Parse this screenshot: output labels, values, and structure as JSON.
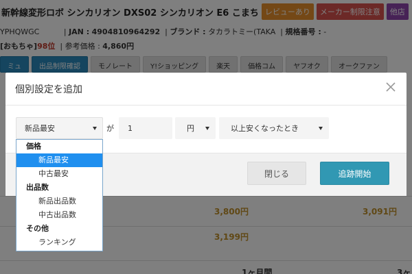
{
  "background": {
    "title": "新幹線変形ロボ シンカリオン DXS02 シンカリオン E6 こまち",
    "badges": [
      {
        "label": "レビューあり",
        "color": "#e8912d"
      },
      {
        "label": "メーカー制限注意",
        "color": "#d9534f"
      },
      {
        "label": "他店",
        "color": "#8e44ad"
      }
    ],
    "info_line1": {
      "asin_tail": "YPHQWGC",
      "jan_label": "JAN :",
      "jan_value": "4904810964292",
      "brand_label": "ブランド :",
      "brand_value": "タカラトミー(TAKA",
      "model_label": "規格番号 :",
      "model_value": "-"
    },
    "info_line2": {
      "category": "[おもちゃ]",
      "rank": "98位",
      "ref_label": "参考価格 :",
      "ref_value": "4,860円"
    },
    "tabs": [
      {
        "label": "ミュ",
        "active": true
      },
      {
        "label": "出品制限確認",
        "active": true
      },
      {
        "label": "モノレート",
        "active": false
      },
      {
        "label": "Y!ショッピング",
        "active": false
      },
      {
        "label": "楽天",
        "active": false
      },
      {
        "label": "価格コム",
        "active": false
      },
      {
        "label": "ヤフオク",
        "active": false
      },
      {
        "label": "オークファン",
        "active": false
      }
    ],
    "table": {
      "price_row1_a": "3,800円",
      "price_row1_b": "3,091円",
      "price_row2_a": "3,199円",
      "period_a": "1ヶ月間",
      "period_b": "3ヶ"
    }
  },
  "modal": {
    "title": "個別設定を追加",
    "close_icon": "close-icon",
    "condition_select": "新品最安",
    "ga_label": "が",
    "amount_value": "1",
    "unit_select": "円",
    "comparison_select": "以上安くなったとき",
    "buttons": {
      "close": "閉じる",
      "start": "追跡開始"
    }
  },
  "dropdown": {
    "groups": [
      {
        "label": "価格",
        "options": [
          {
            "label": "新品最安",
            "selected": true
          },
          {
            "label": "中古最安",
            "selected": false
          }
        ]
      },
      {
        "label": "出品数",
        "options": [
          {
            "label": "新品出品数",
            "selected": false
          },
          {
            "label": "中古出品数",
            "selected": false
          }
        ]
      },
      {
        "label": "その他",
        "options": [
          {
            "label": "ランキング",
            "selected": false
          }
        ]
      }
    ]
  },
  "colors": {
    "accent": "#3198b3",
    "selected_option": "#1f8fef",
    "badge_orange": "#e8912d",
    "badge_red": "#d9534f",
    "price_text": "#c0902b"
  }
}
